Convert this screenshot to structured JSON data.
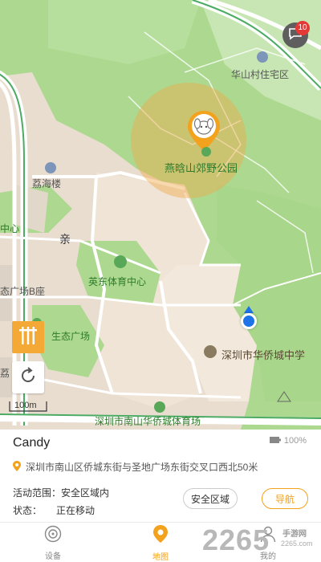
{
  "map": {
    "labels": {
      "huashan": "华山村住宅区",
      "park": "燕晗山郊野公园",
      "lihai": "荔海楼",
      "zhongxin": "中心",
      "qin": "亲",
      "yingdong": "英东体育中心",
      "shengtai_b": "态广场B座",
      "shengtai": "生态广场",
      "school": "深圳市华侨城中学",
      "lihai2": "荔",
      "road_bottom": "深圳市南山华侨城体育场"
    },
    "message_badge": "10",
    "scale": "100m",
    "icons": {
      "message": "message-icon",
      "fence": "fence-icon",
      "refresh": "refresh-icon",
      "pin": "device-pin-icon"
    }
  },
  "panel": {
    "device_name": "Candy",
    "battery": "100%",
    "address": "深圳市南山区侨城东街与圣地广场东街交叉口西北50米",
    "activity_label": "活动范围：",
    "activity_value": "安全区域内",
    "status_label": "状态：",
    "status_value": "正在移动",
    "safe_zone_button": "安全区域",
    "navigate_button": "导航"
  },
  "tabs": {
    "device": "设备",
    "map": "地图",
    "mine": "我的"
  },
  "watermark": {
    "main": "2265",
    "sub1": "手游网",
    "sub2": "2265.com"
  },
  "colors": {
    "accent": "#f2a21c",
    "location": "#1e73e8",
    "map_green": "#a9d88f",
    "map_beige": "#efe3d3"
  }
}
